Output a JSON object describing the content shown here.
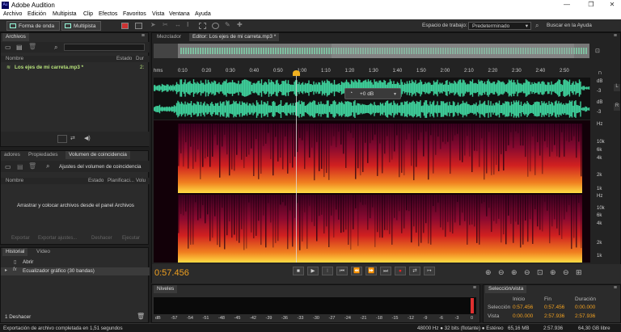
{
  "app": {
    "title": "Adobe Audition",
    "logo_text": "Au"
  },
  "menu": [
    "Archivo",
    "Edición",
    "Multipista",
    "Clip",
    "Efectos",
    "Favoritos",
    "Vista",
    "Ventana",
    "Ayuda"
  ],
  "toolbar": {
    "waveform_label": "Forma de onda",
    "multitrack_label": "Multipista",
    "workspace_label": "Espacio de trabajo:",
    "workspace_value": "Predeterminado",
    "search_placeholder": "Buscar en la Ayuda"
  },
  "files_panel": {
    "tab": "Archivos",
    "columns": [
      "Nombre",
      "Estado",
      "Dur"
    ],
    "items": [
      {
        "name": "Los ejes de mi carreta.mp3 *",
        "duration": "2:"
      }
    ]
  },
  "match_panel": {
    "tabs": [
      "adores",
      "Propiedades",
      "Volumen de coincidencia"
    ],
    "settings_label": "Ajustes del volumen de coincidencia",
    "columns": [
      "Nombre",
      "Estado",
      "Planificaci...",
      "Volu"
    ],
    "drop_hint": "Arrastrar y colocar archivos desde el panel Archivos",
    "buttons": [
      "Exportar",
      "Exportar ajustes...",
      "Deshacer",
      "Ejecutar"
    ]
  },
  "history_panel": {
    "tabs": [
      "Historial",
      "Vídeo"
    ],
    "items": [
      {
        "label": "Abrir",
        "icon": "document-icon"
      },
      {
        "label": "Ecualizador gráfico (30 bandas)",
        "icon": "fx-icon"
      }
    ],
    "undo_count": "1 Deshacer"
  },
  "editor": {
    "tabs": [
      "Mezclador",
      "Editor: Los ejes de mi carreta.mp3 *"
    ],
    "ruler_unit": "hms",
    "ruler_ticks": [
      "0:10",
      "0:20",
      "0:30",
      "0:40",
      "0:50",
      "1:00",
      "1:10",
      "1:20",
      "1:30",
      "1:40",
      "1:50",
      "2:00",
      "2:10",
      "2:20",
      "2:30",
      "2:40",
      "2:50"
    ],
    "db_labels_wave": [
      "dB",
      "-3",
      "dB",
      "-3"
    ],
    "hud_value": "+0 dB",
    "freq_labels": [
      "Hz",
      "10k",
      "6k",
      "4k",
      "2k",
      "1k"
    ],
    "channel_labels": [
      "L",
      "R"
    ],
    "time_display": "0:57.456"
  },
  "levels_panel": {
    "tab": "Niveles",
    "scale": [
      "dB",
      "-57",
      "-54",
      "-51",
      "-48",
      "-45",
      "-42",
      "-39",
      "-36",
      "-33",
      "-30",
      "-27",
      "-24",
      "-21",
      "-18",
      "-15",
      "-12",
      "-9",
      "-6",
      "-3",
      "0"
    ]
  },
  "selection_panel": {
    "tab": "Selección/vista",
    "headers": [
      "Inicio",
      "Fin",
      "Duración"
    ],
    "rows": [
      {
        "label": "Selección",
        "start": "0:57.456",
        "end": "0:57.456",
        "duration": "0:00.000"
      },
      {
        "label": "Vista",
        "start": "0:00.000",
        "end": "2:57.936",
        "duration": "2:57.936"
      }
    ]
  },
  "status": {
    "message": "Exportación de archivo completada en 1,51 segundos",
    "format": "48000 Hz ● 32 bits (flotante) ● Estéreo",
    "file_size": "65,16 MB",
    "duration": "2:57.936",
    "free_space": "64,30 GB libre"
  },
  "colors": {
    "waveform": "#3ecf9a",
    "accent_time": "#f0a020",
    "spectral_hot": "#ffdd44",
    "spectral_cold": "#1a0010"
  }
}
